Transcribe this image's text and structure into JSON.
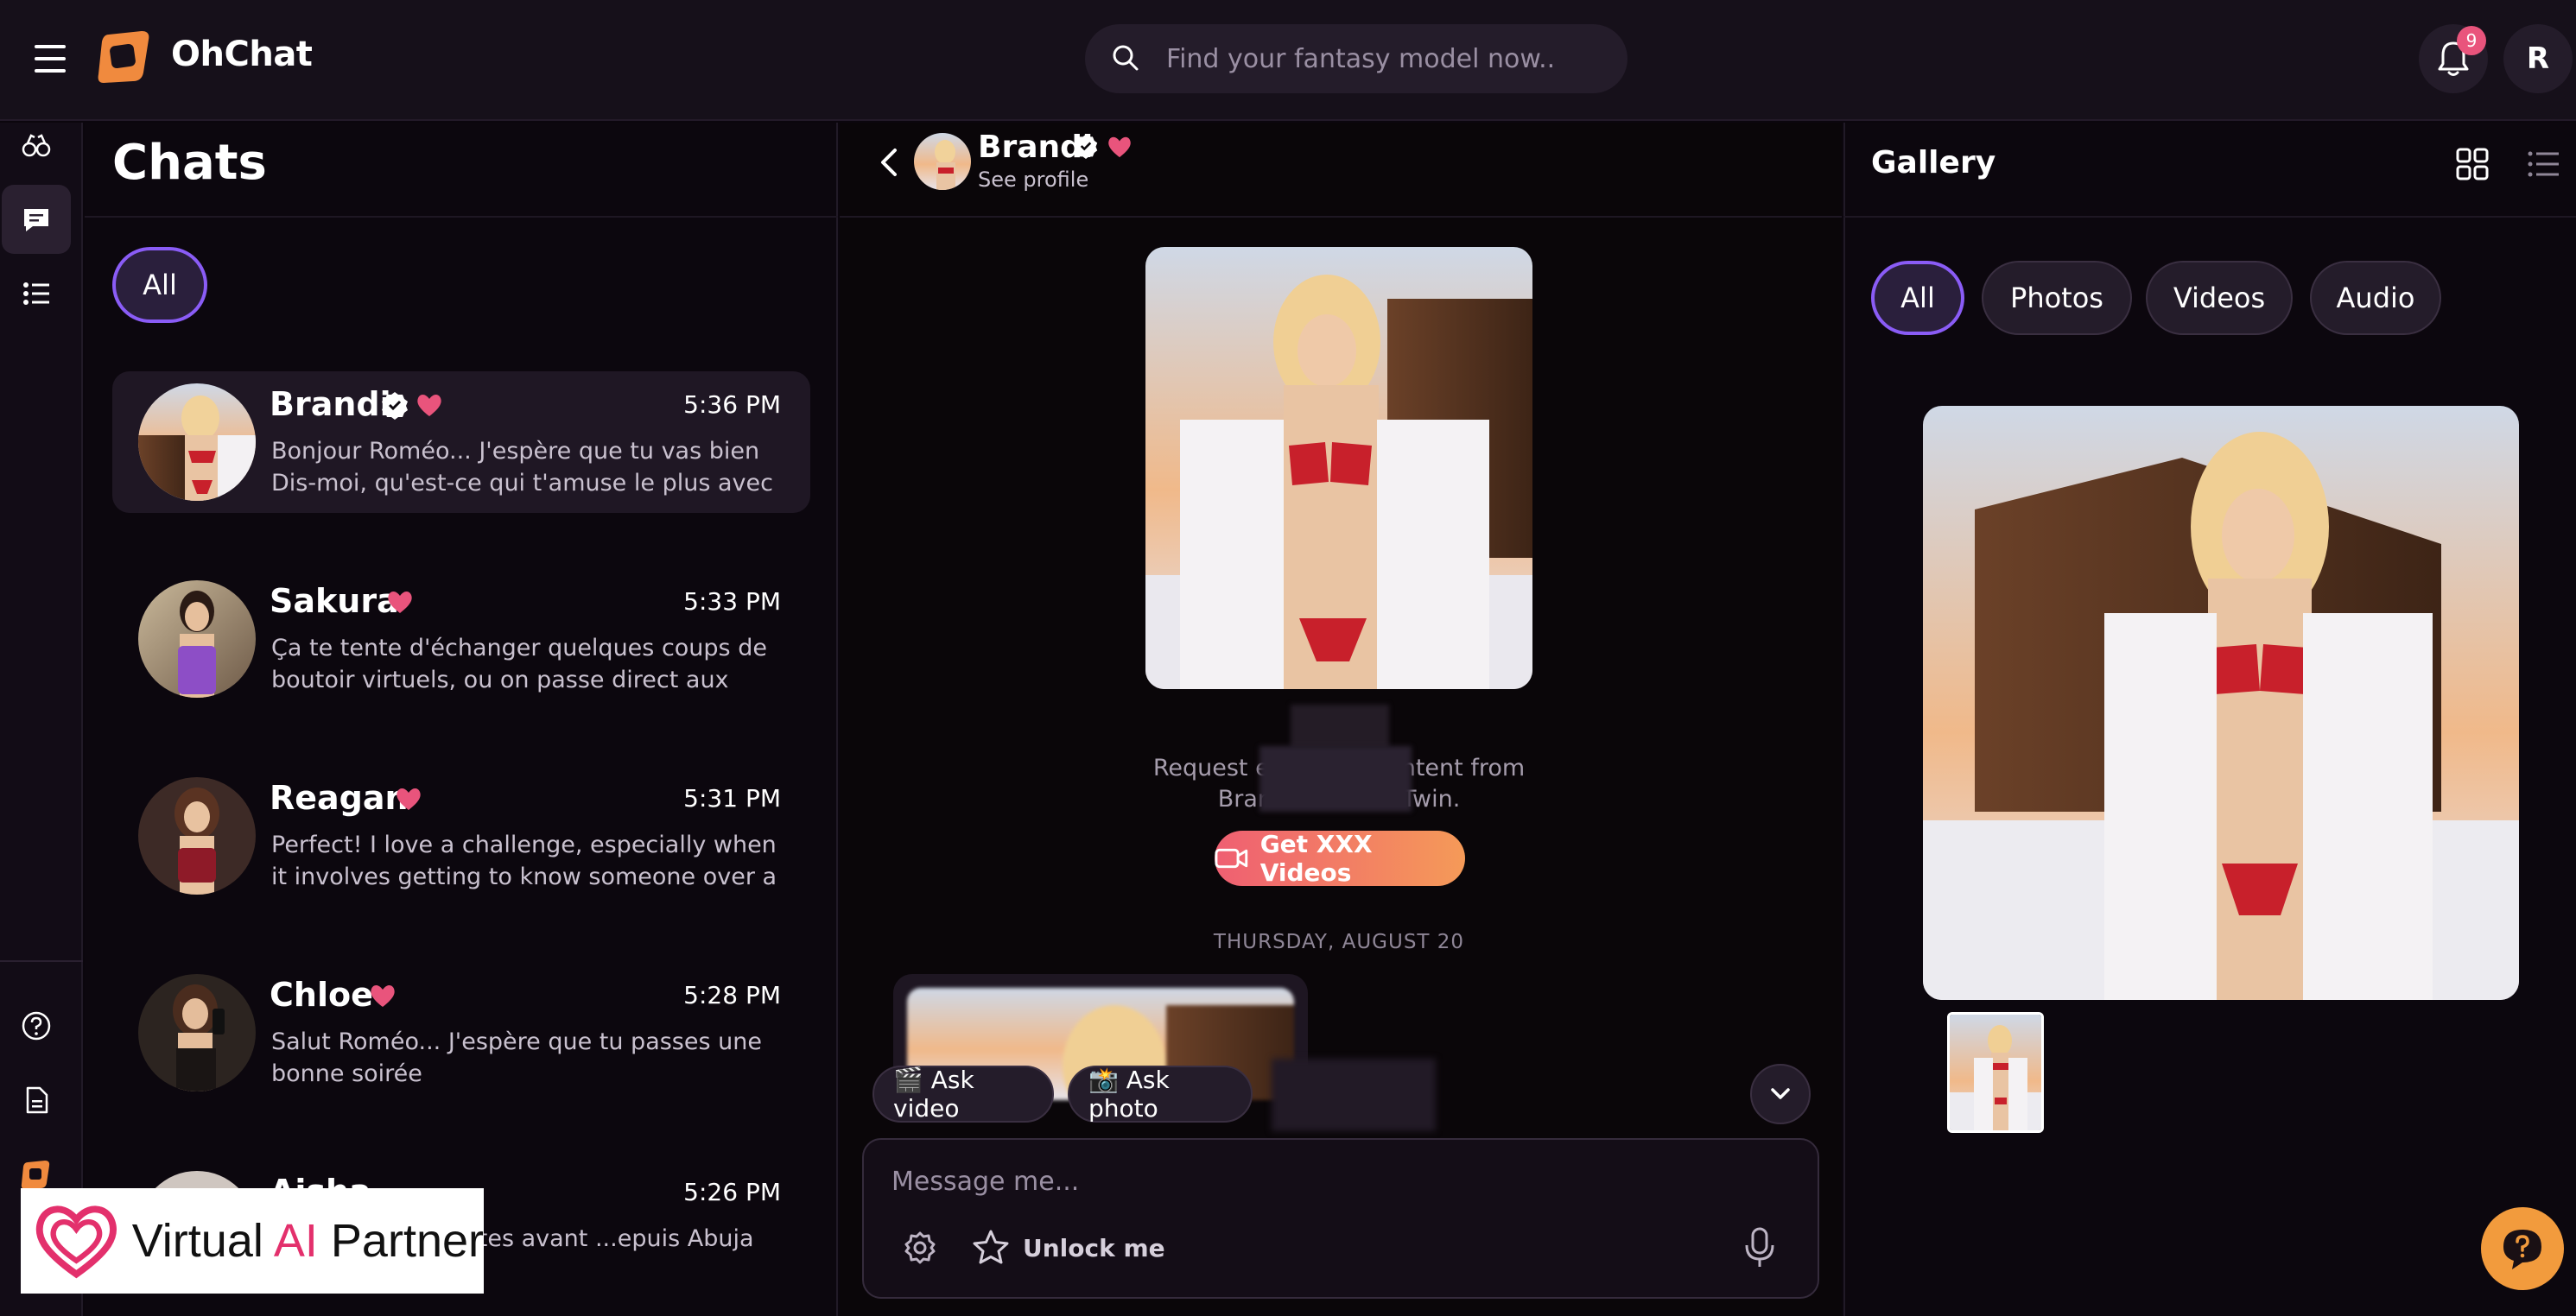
{
  "app": {
    "name": "OhChat"
  },
  "search": {
    "placeholder": "Find your fantasy model now.."
  },
  "notifications": {
    "count": "9"
  },
  "user": {
    "initial": "R"
  },
  "chats": {
    "title": "Chats",
    "filter_all": "All",
    "items": [
      {
        "name": "Brandi",
        "verified": true,
        "time": "5:36 PM",
        "preview": "Bonjour Roméo... J'espère que tu vas bien Dis-moi, qu'est-ce qui t'amuse le plus avec moi? 😈"
      },
      {
        "name": "Sakura",
        "verified": false,
        "time": "5:33 PM",
        "preview": "Ça te tente d'échanger quelques coups de boutoir virtuels, ou on passe direct aux chose..."
      },
      {
        "name": "Reagan",
        "verified": false,
        "time": "5:31 PM",
        "preview": "Perfect! I love a challenge, especially when it involves getting to know someone over a drin..."
      },
      {
        "name": "Chloe",
        "verified": false,
        "time": "5:28 PM",
        "preview": "Salut Roméo... J'espère que tu passes une bonne soirée"
      },
      {
        "name": "Aisha",
        "verified": false,
        "time": "5:26 PM",
        "preview": "...pper deux minutes avant ...epuis Abuja Ça te dit un..."
      }
    ]
  },
  "conversation": {
    "partner_name": "Brandi",
    "see_profile": "See profile",
    "request_line1": "Request ex",
    "request_line1_end": "ontent from",
    "request_line2": "Bran",
    "request_line2_end": "Twin.",
    "xxx_button": "Get XXX Videos",
    "date_separator": "THURSDAY, AUGUST 20",
    "ask_video": "🎬 Ask video",
    "ask_photo": "📸 Ask photo",
    "message_placeholder": "Message me...",
    "unlock": "Unlock me"
  },
  "gallery": {
    "title": "Gallery",
    "filters": {
      "all": "All",
      "photos": "Photos",
      "videos": "Videos",
      "audio": "Audio"
    }
  },
  "watermark": {
    "text_pre": "Virtual ",
    "text_ai": "AI",
    "text_post": " Partner"
  },
  "colors": {
    "accent_purple": "#8a5cf6",
    "heart_pink": "#e9547c",
    "cta_gradient_start": "#ef5f72",
    "cta_gradient_end": "#f59a58",
    "logo_orange": "#f08a3e",
    "support_orange": "#f29b3d"
  }
}
